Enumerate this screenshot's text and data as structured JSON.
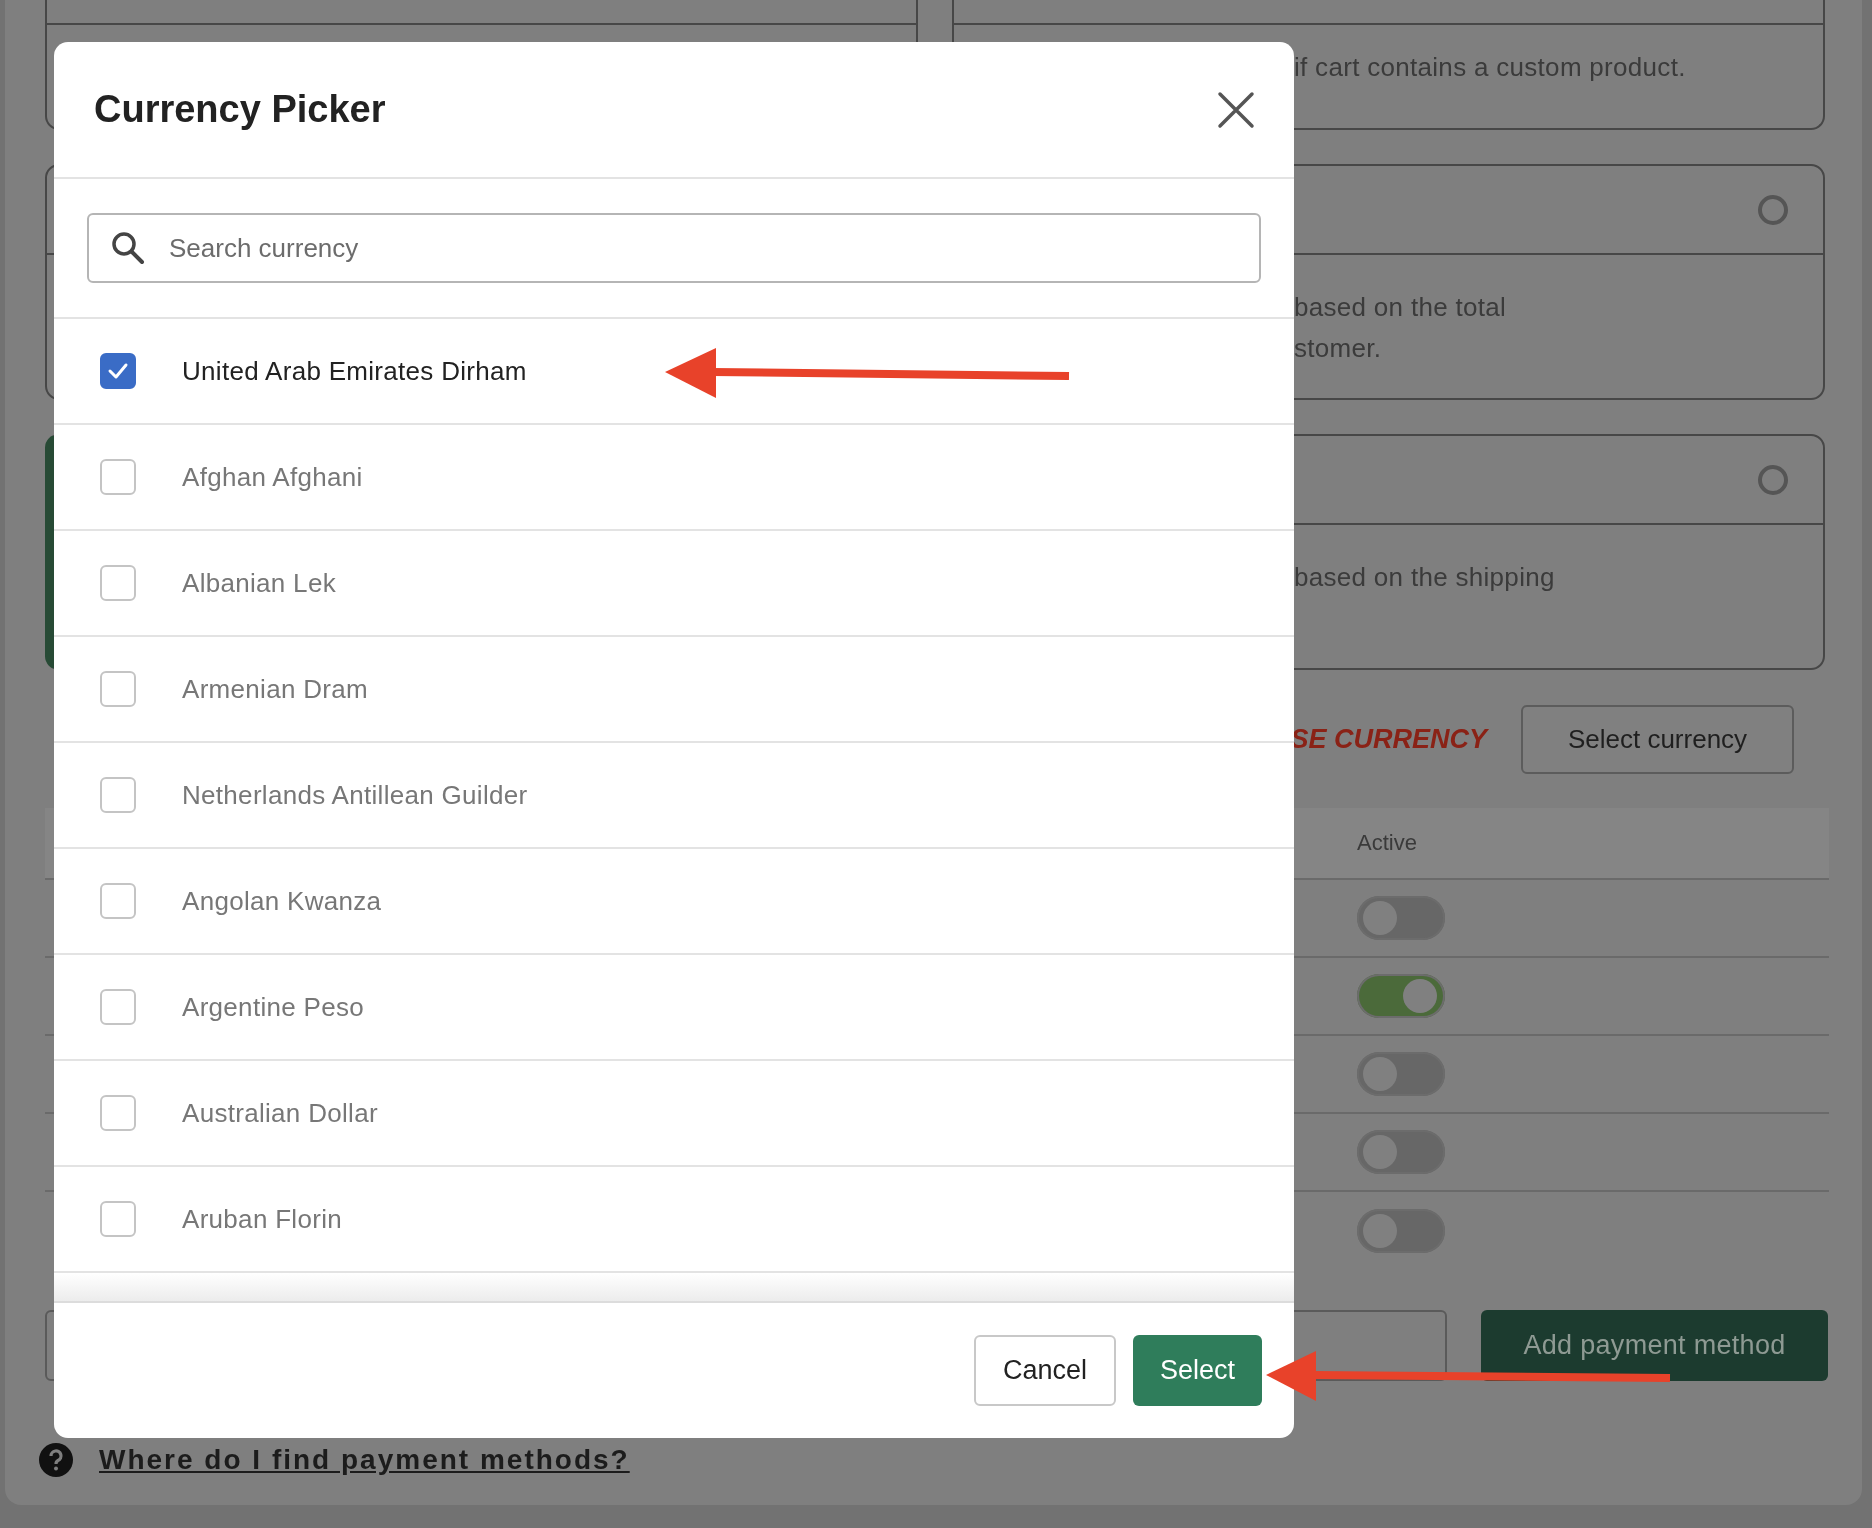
{
  "background": {
    "left_cards": [
      {
        "selected": false
      },
      {
        "selected": false
      },
      {
        "selected": true
      }
    ],
    "right_cards": [
      {
        "text": "if cart contains a custom product."
      },
      {
        "text": "based on the total\nstomer.",
        "radio_selected": false
      },
      {
        "text": "based on the shipping",
        "radio_selected": false
      }
    ],
    "currency_row": {
      "warning": "SE CURRENCY",
      "button": "Select currency"
    },
    "table": {
      "header": "Active",
      "toggles": [
        {
          "on": false
        },
        {
          "on": true
        },
        {
          "on": false
        },
        {
          "on": false
        },
        {
          "on": false
        }
      ]
    },
    "add_button": "Add payment method",
    "help_link": "Where do I find payment methods?"
  },
  "modal": {
    "title": "Currency Picker",
    "search": {
      "placeholder": "Search currency"
    },
    "items": [
      {
        "label": "United Arab Emirates Dirham",
        "checked": true
      },
      {
        "label": "Afghan Afghani",
        "checked": false
      },
      {
        "label": "Albanian Lek",
        "checked": false
      },
      {
        "label": "Armenian Dram",
        "checked": false
      },
      {
        "label": "Netherlands Antillean Guilder",
        "checked": false
      },
      {
        "label": "Angolan Kwanza",
        "checked": false
      },
      {
        "label": "Argentine Peso",
        "checked": false
      },
      {
        "label": "Australian Dollar",
        "checked": false
      },
      {
        "label": "Aruban Florin",
        "checked": false
      }
    ],
    "buttons": [
      {
        "label": "Cancel",
        "kind": "secondary"
      },
      {
        "label": "Select",
        "kind": "primary"
      }
    ]
  }
}
